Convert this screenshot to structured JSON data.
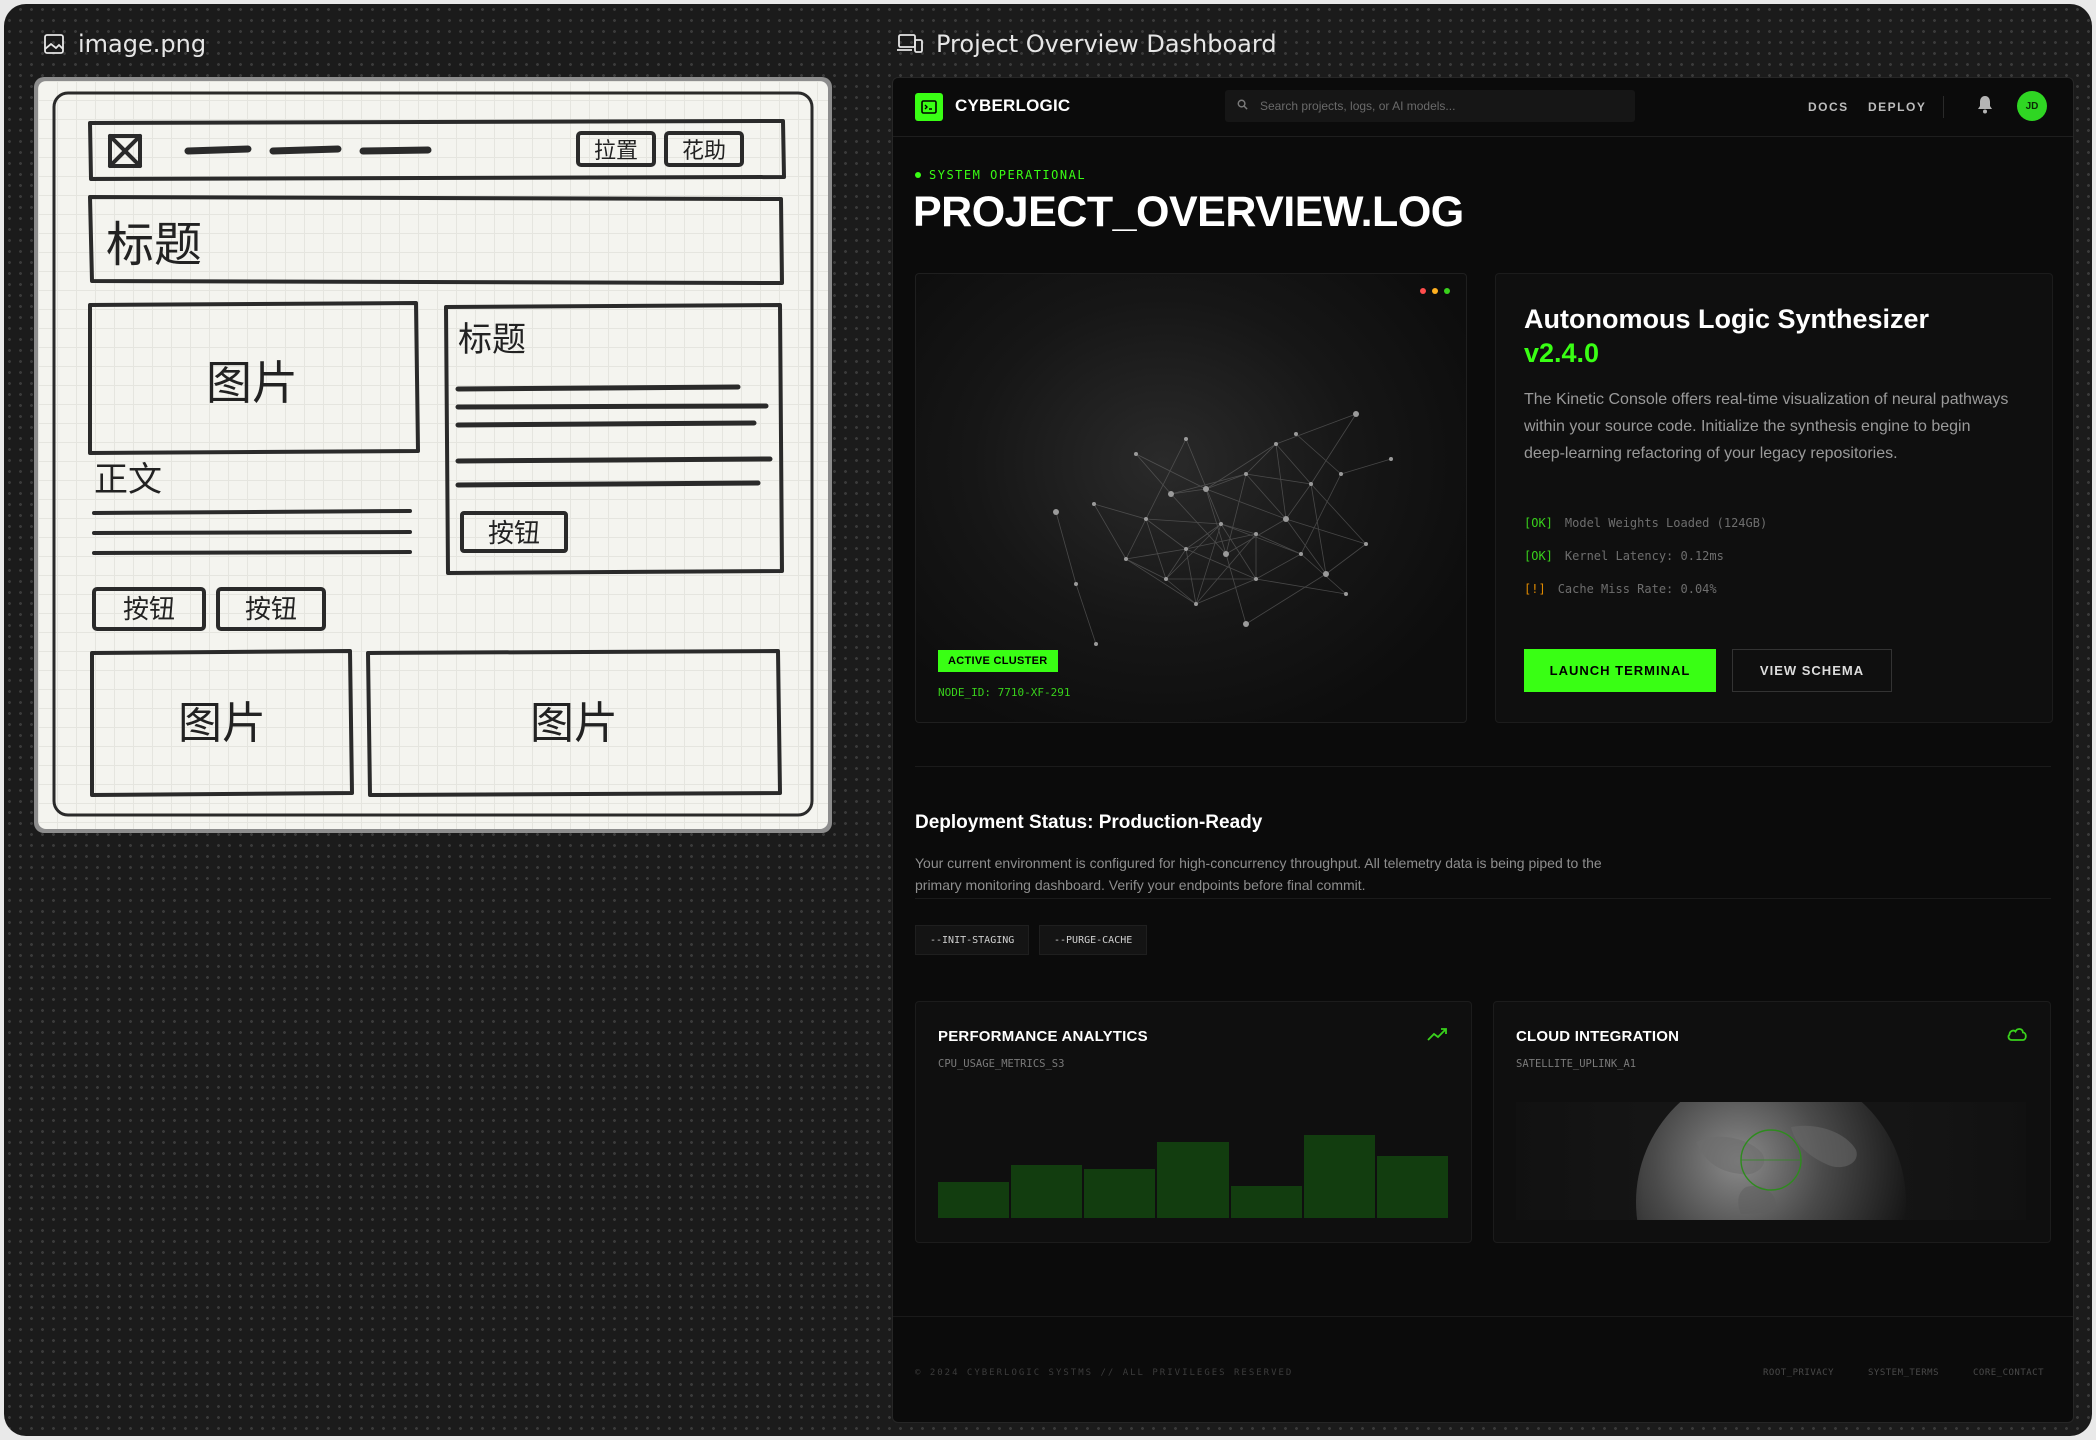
{
  "left_pane": {
    "filename": "image.png"
  },
  "right_pane": {
    "title": "Project Overview Dashboard"
  },
  "sketch": {
    "nav_buttons": [
      "拉置",
      "花助"
    ],
    "header_title": "标题",
    "image_label": "图片",
    "side_title": "标题",
    "body_label": "正文",
    "side_button": "按钮",
    "buttons": [
      "按钮",
      "按钮"
    ],
    "bottom_images": [
      "图片",
      "图片"
    ]
  },
  "app": {
    "brand": "CYBERLOGIC",
    "search_placeholder": "Search projects, logs, or AI models...",
    "nav_links": [
      "DOCS",
      "DEPLOY"
    ],
    "avatar_initials": "JD",
    "status_text": "SYSTEM OPERATIONAL",
    "page_title": "PROJECT_OVERVIEW.LOG",
    "viz": {
      "badge": "ACTIVE CLUSTER",
      "node_id": "NODE_ID: 7710-XF-291"
    },
    "info": {
      "title": "Autonomous Logic Synthesizer",
      "version": "v2.4.0",
      "description": "The Kinetic Console offers real-time visualization of neural pathways within your source code. Initialize the synthesis engine to begin deep-learning refactoring of your legacy repositories.",
      "logs": [
        {
          "tag": "[OK]",
          "text": "Model Weights Loaded (124GB)"
        },
        {
          "tag": "[OK]",
          "text": "Kernel Latency: 0.12ms"
        },
        {
          "tag": "[!]",
          "text": "Cache Miss Rate: 0.04%"
        }
      ],
      "primary_button": "LAUNCH TERMINAL",
      "secondary_button": "VIEW SCHEMA"
    },
    "deployment": {
      "title": "Deployment Status: Production-Ready",
      "description": "Your current environment is configured for high-concurrency throughput. All telemetry data is being piped to the primary monitoring dashboard. Verify your endpoints before final commit.",
      "commands": [
        "--INIT-STAGING",
        "--PURGE-CACHE"
      ]
    },
    "performance": {
      "title": "PERFORMANCE ANALYTICS",
      "subtitle": "CPU_USAGE_METRICS_S3",
      "bar_levels": [
        0.42,
        0.62,
        0.57,
        0.88,
        0.37,
        0.97,
        0.72
      ]
    },
    "cloud": {
      "title": "CLOUD INTEGRATION",
      "subtitle": "SATELLITE_UPLINK_A1"
    },
    "footer": {
      "copyright": "© 2024 CYBERLOGIC SYSTMS // ALL PRIVILEGES RESERVED",
      "links": [
        "ROOT_PRIVACY",
        "SYSTEM_TERMS",
        "CORE_CONTACT"
      ]
    },
    "colors": {
      "accent": "#39ff14",
      "background": "#0b0b0b",
      "warn": "#e08a00"
    }
  }
}
